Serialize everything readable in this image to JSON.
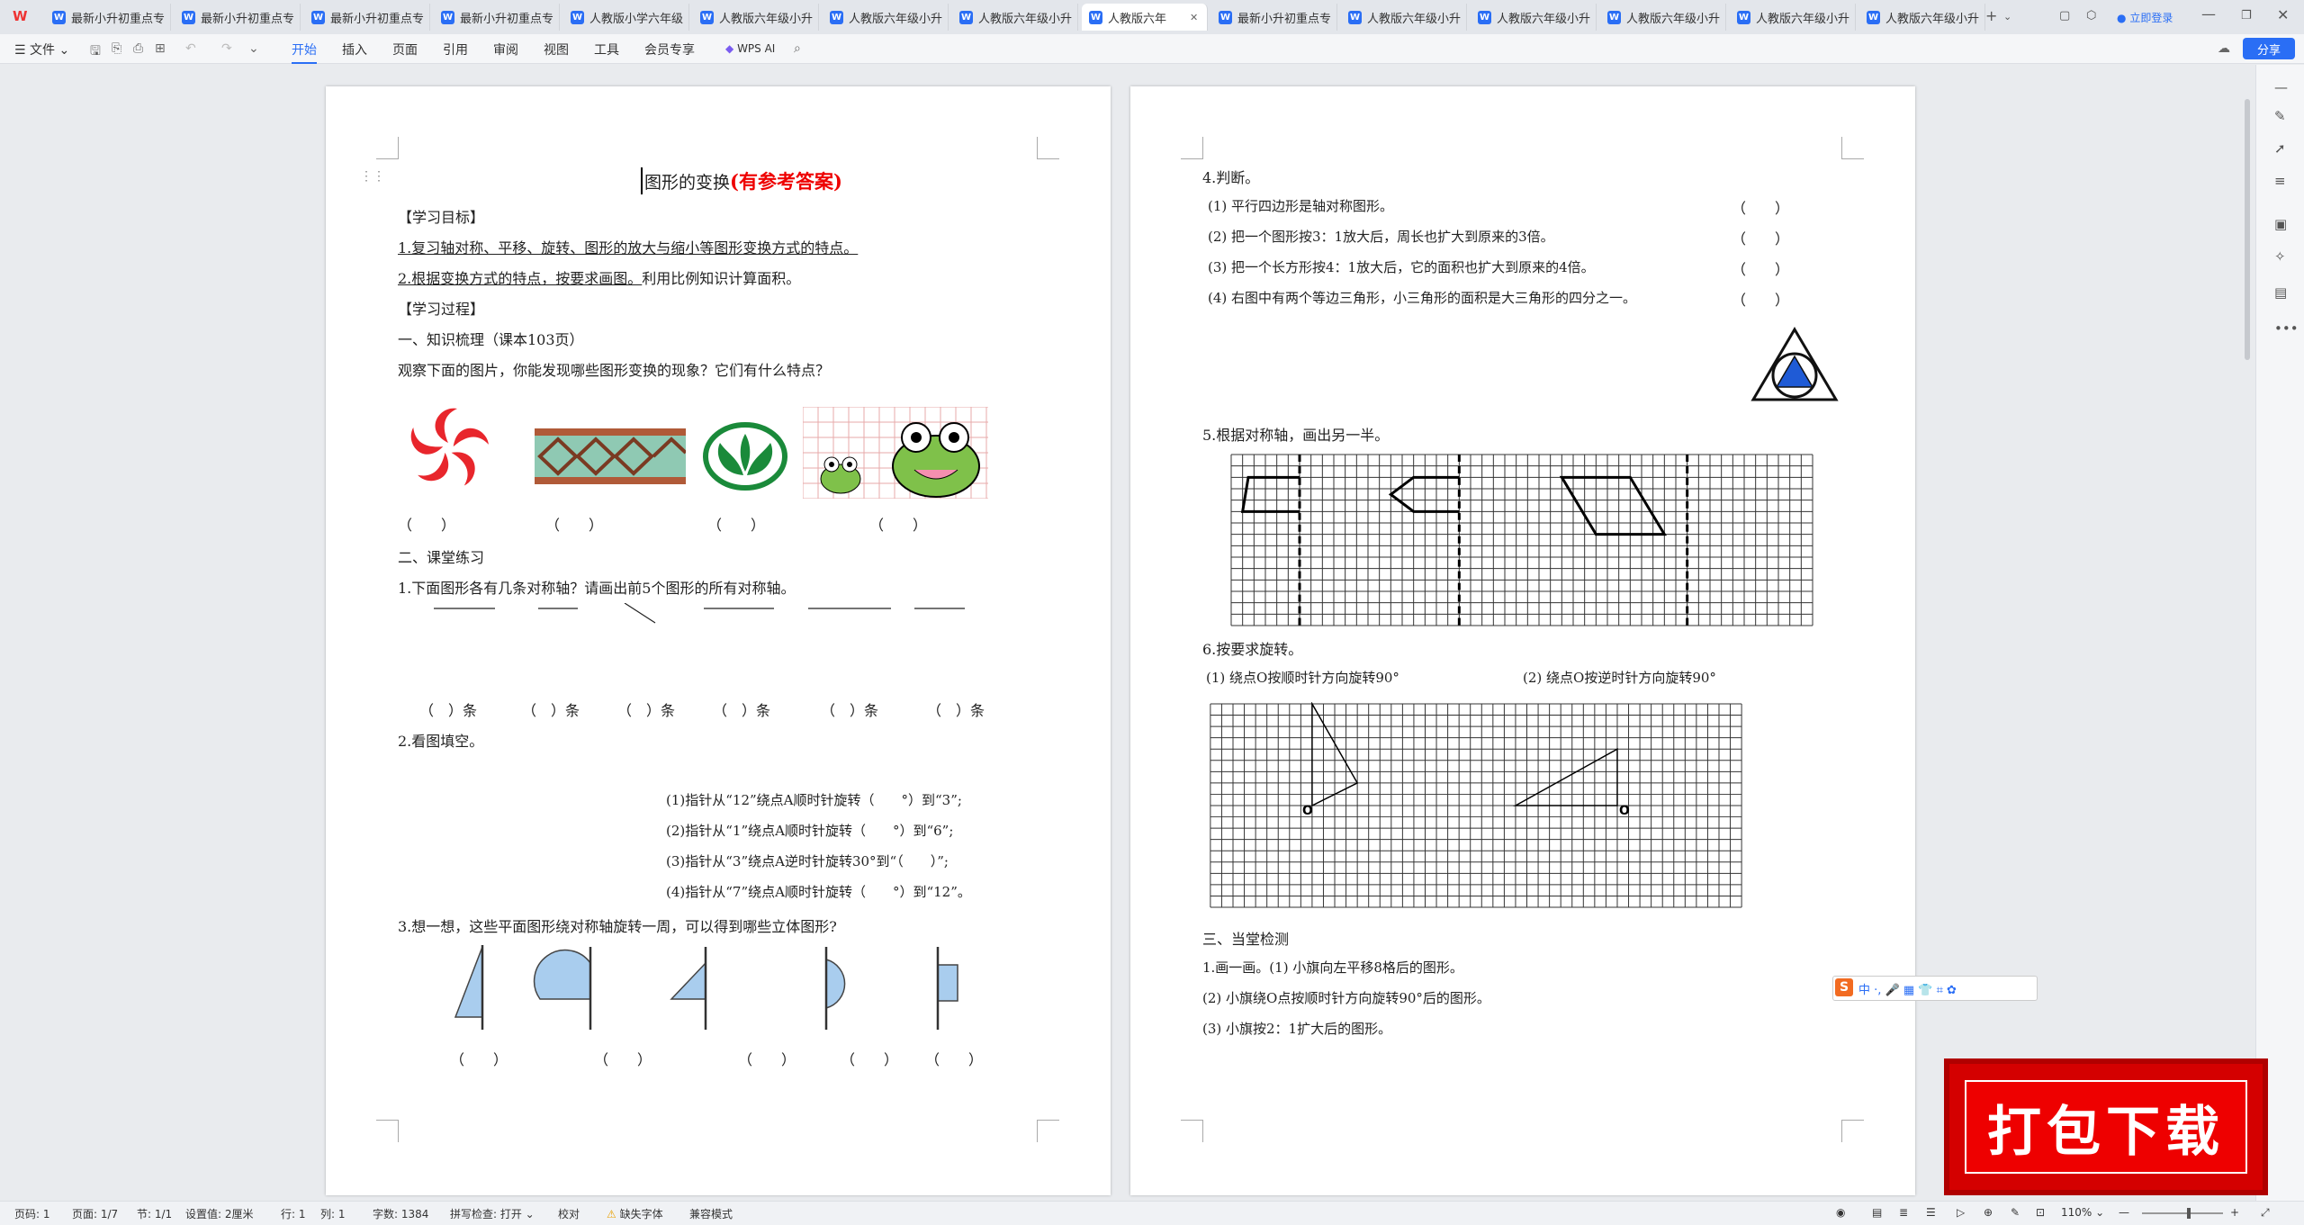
{
  "tabs": [
    "最新小升初重点专",
    "最新小升初重点专",
    "最新小升初重点专",
    "最新小升初重点专",
    "人教版小学六年级",
    "人教版六年级小升",
    "人教版六年级小升",
    "人教版六年级小升",
    "人教版六年",
    "最新小升初重点专",
    "人教版六年级小升",
    "人教版六年级小升",
    "人教版六年级小升",
    "人教版六年级小升",
    "人教版六年级小升"
  ],
  "login": "立即登录",
  "menu": {
    "file": "文件",
    "items": [
      "开始",
      "插入",
      "页面",
      "引用",
      "审阅",
      "视图",
      "工具",
      "会员专享"
    ],
    "wps_ai": "WPS AI"
  },
  "share": "分享",
  "page1": {
    "title": "图形的变换",
    "title_red": "(有参考答案)",
    "sec_goal": "【学习目标】",
    "goal1": "1.复习轴对称、平移、旋转、图形的放大与缩小等图形变换方式的特点。",
    "goal2_u": "2.根据变换方式的特点，按要求画图。",
    "goal2_rest": "利用比例知识计算面积。",
    "sec_process": "【学习过程】",
    "part1": "一、知识梳理（课本103页）",
    "observe": "观察下面的图片，你能发现哪些图形变换的现象？它们有什么特点？",
    "paren": "（　　）",
    "part2": "二、课堂练习",
    "q1": "1.下面图形各有几条对称轴？请画出前5个图形的所有对称轴。",
    "tiao": "（　）条",
    "q2": "2.看图填空。",
    "q2_lines": [
      "(1)指针从“12”绕点A顺时针旋转（　　°）到“3”;",
      "(2)指针从“1”绕点A顺时针旋转（　　°）到“6”;",
      "(3)指针从“3”绕点A逆时针旋转30°到“（　　）”;",
      "(4)指针从“7”绕点A顺时针旋转（　　°）到“12”。"
    ],
    "q3": "3.想一想，这些平面图形绕对称轴旋转一周，可以得到哪些立体图形?",
    "paren_short": "（　　）"
  },
  "page2": {
    "q4": "4.判断。",
    "judge": [
      "(1) 平行四边形是轴对称图形。",
      "(2) 把一个图形按3：1放大后，周长也扩大到原来的3倍。",
      "(3) 把一个长方形按4：1放大后，它的面积也扩大到原来的4倍。",
      "(4) 右图中有两个等边三角形，小三角形的面积是大三角形的四分之一。"
    ],
    "judge_paren": "（　　）",
    "q5": "5.根据对称轴，画出另一半。",
    "q6": "6.按要求旋转。",
    "q6_a": "(1) 绕点O按顺时针方向旋转90°",
    "q6_b": "(2) 绕点O按逆时针方向旋转90°",
    "o_label": "O",
    "part3": "三、当堂检测",
    "t1": "1.画一画。(1) 小旗向左平移8格后的图形。",
    "t2": "(2) 小旗绕O点按顺时针方向旋转90°后的图形。",
    "t3": "(3) 小旗按2：1扩大后的图形。"
  },
  "ime": "中 ·, 🎤 ▦ 👕 ⌗ ✿",
  "badge": "打包下载",
  "status": {
    "page": "页码: 1",
    "pages": "页面: 1/7",
    "section": "节: 1/1",
    "setting": "设置值: 2厘米",
    "row": "行: 1",
    "col": "列: 1",
    "words": "字数: 1384",
    "spell": "拼写检查: 打开",
    "proof": "校对",
    "missing_font": "缺失字体",
    "compat": "兼容模式",
    "zoom": "110%"
  }
}
